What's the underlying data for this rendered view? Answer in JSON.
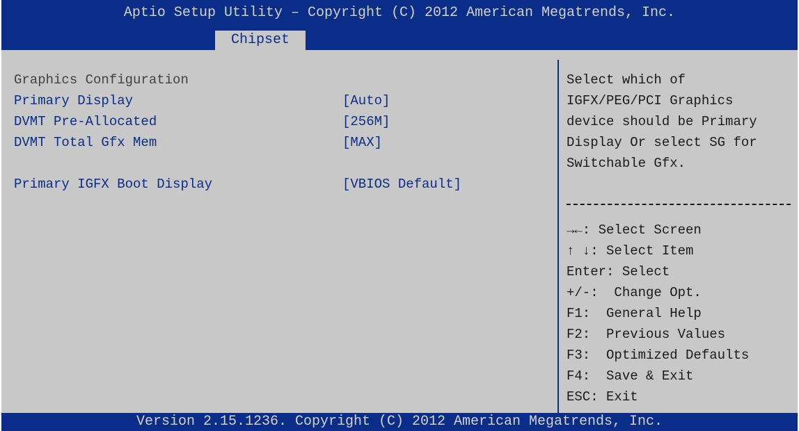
{
  "header": {
    "title": "Aptio Setup Utility – Copyright (C) 2012 American Megatrends, Inc."
  },
  "tabs": [
    {
      "label": "Chipset",
      "active": true
    }
  ],
  "main": {
    "section_title": "Graphics Configuration",
    "items": [
      {
        "label": "Primary Display",
        "value": "[Auto]"
      },
      {
        "label": "DVMT Pre-Allocated",
        "value": "[256M]"
      },
      {
        "label": "DVMT Total Gfx Mem",
        "value": "[MAX]"
      },
      {
        "label": "Primary IGFX Boot Display",
        "value": "[VBIOS Default]"
      }
    ]
  },
  "help": {
    "lines": [
      "Select which of",
      "IGFX/PEG/PCI Graphics",
      "device should be Primary",
      "Display Or select SG for",
      "Switchable Gfx."
    ]
  },
  "keys": [
    "→←: Select Screen",
    "↑ ↓: Select Item",
    "Enter: Select",
    "+/-:  Change Opt.",
    "F1:  General Help",
    "F2:  Previous Values",
    "F3:  Optimized Defaults",
    "F4:  Save & Exit",
    "ESC: Exit"
  ],
  "footer": {
    "text": "Version 2.15.1236. Copyright (C) 2012 American Megatrends, Inc."
  },
  "colors": {
    "frame_blue": "#0a2d8a",
    "panel_gray": "#c8c8c8",
    "title_text": "#d2d2d2"
  }
}
